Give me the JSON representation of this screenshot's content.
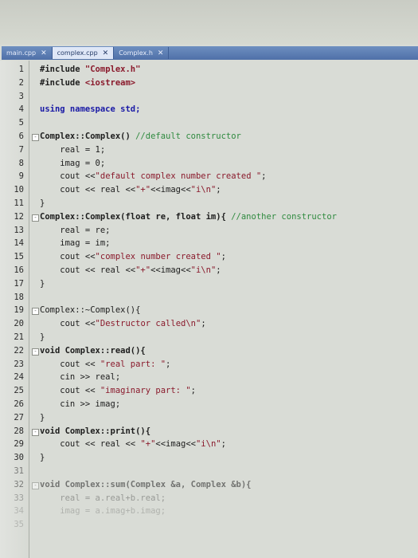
{
  "tabs": [
    {
      "label": "main.cpp",
      "active": false
    },
    {
      "label": "complex.cpp",
      "active": true
    },
    {
      "label": "Complex.h",
      "active": false
    }
  ],
  "lines": [
    {
      "n": "1",
      "parts": [
        {
          "t": "#include ",
          "c": "bold"
        },
        {
          "t": "\"Complex.h\"",
          "c": "str bold"
        }
      ]
    },
    {
      "n": "2",
      "parts": [
        {
          "t": "#include ",
          "c": "bold"
        },
        {
          "t": "<iostream>",
          "c": "str bold"
        }
      ]
    },
    {
      "n": "3",
      "parts": []
    },
    {
      "n": "4",
      "parts": [
        {
          "t": "using namespace std;",
          "c": "kw"
        }
      ]
    },
    {
      "n": "5",
      "parts": []
    },
    {
      "n": "6",
      "parts": [
        {
          "t": "Complex::Complex() ",
          "c": "bold"
        },
        {
          "t": "//default constructor",
          "c": "cm"
        }
      ]
    },
    {
      "n": "7",
      "parts": [
        {
          "t": "    real = 1;",
          "c": ""
        }
      ]
    },
    {
      "n": "8",
      "parts": [
        {
          "t": "    imag = 0;",
          "c": ""
        }
      ]
    },
    {
      "n": "9",
      "parts": [
        {
          "t": "    cout <<",
          "c": ""
        },
        {
          "t": "\"default complex number created \"",
          "c": "str"
        },
        {
          "t": ";",
          "c": ""
        }
      ]
    },
    {
      "n": "10",
      "parts": [
        {
          "t": "    cout << real <<",
          "c": ""
        },
        {
          "t": "\"+\"",
          "c": "str"
        },
        {
          "t": "<<imag<<",
          "c": ""
        },
        {
          "t": "\"i\\n\"",
          "c": "str"
        },
        {
          "t": ";",
          "c": ""
        }
      ]
    },
    {
      "n": "11",
      "parts": [
        {
          "t": "}",
          "c": ""
        }
      ]
    },
    {
      "n": "12",
      "parts": [
        {
          "t": "Complex::Complex(float re, float im){ ",
          "c": "bold"
        },
        {
          "t": "//another constructor",
          "c": "cm"
        }
      ]
    },
    {
      "n": "13",
      "parts": [
        {
          "t": "    real = re;",
          "c": ""
        }
      ]
    },
    {
      "n": "14",
      "parts": [
        {
          "t": "    imag = im;",
          "c": ""
        }
      ]
    },
    {
      "n": "15",
      "parts": [
        {
          "t": "    cout <<",
          "c": ""
        },
        {
          "t": "\"complex number created \"",
          "c": "str"
        },
        {
          "t": ";",
          "c": ""
        }
      ]
    },
    {
      "n": "16",
      "parts": [
        {
          "t": "    cout << real <<",
          "c": ""
        },
        {
          "t": "\"+\"",
          "c": "str"
        },
        {
          "t": "<<imag<<",
          "c": ""
        },
        {
          "t": "\"i\\n\"",
          "c": "str"
        },
        {
          "t": ";",
          "c": ""
        }
      ]
    },
    {
      "n": "17",
      "parts": [
        {
          "t": "}",
          "c": ""
        }
      ]
    },
    {
      "n": "18",
      "parts": []
    },
    {
      "n": "19",
      "parts": [
        {
          "t": "Complex::~Complex(){",
          "c": ""
        }
      ]
    },
    {
      "n": "20",
      "parts": [
        {
          "t": "    cout <<",
          "c": ""
        },
        {
          "t": "\"Destructor called\\n\"",
          "c": "str"
        },
        {
          "t": ";",
          "c": ""
        }
      ]
    },
    {
      "n": "21",
      "parts": [
        {
          "t": "}",
          "c": ""
        }
      ]
    },
    {
      "n": "22",
      "parts": [
        {
          "t": "void Complex::read(){",
          "c": "bold"
        }
      ]
    },
    {
      "n": "23",
      "parts": [
        {
          "t": "    cout << ",
          "c": ""
        },
        {
          "t": "\"real part: \"",
          "c": "str"
        },
        {
          "t": ";",
          "c": ""
        }
      ]
    },
    {
      "n": "24",
      "parts": [
        {
          "t": "    cin >> real;",
          "c": ""
        }
      ]
    },
    {
      "n": "25",
      "parts": [
        {
          "t": "    cout << ",
          "c": ""
        },
        {
          "t": "\"imaginary part: \"",
          "c": "str"
        },
        {
          "t": ";",
          "c": ""
        }
      ]
    },
    {
      "n": "26",
      "parts": [
        {
          "t": "    cin >> imag;",
          "c": ""
        }
      ]
    },
    {
      "n": "27",
      "parts": [
        {
          "t": "}",
          "c": ""
        }
      ]
    },
    {
      "n": "28",
      "parts": [
        {
          "t": "void Complex::print(){",
          "c": "bold"
        }
      ]
    },
    {
      "n": "29",
      "parts": [
        {
          "t": "    cout << real << ",
          "c": ""
        },
        {
          "t": "\"+\"",
          "c": "str"
        },
        {
          "t": "<<imag<<",
          "c": ""
        },
        {
          "t": "\"i\\n\"",
          "c": "str"
        },
        {
          "t": ";",
          "c": ""
        }
      ]
    },
    {
      "n": "30",
      "parts": [
        {
          "t": "}",
          "c": ""
        }
      ]
    },
    {
      "n": "31",
      "parts": []
    },
    {
      "n": "32",
      "parts": [
        {
          "t": "void Complex::sum(Complex &a, Complex &b){",
          "c": "bold"
        }
      ]
    },
    {
      "n": "33",
      "parts": [
        {
          "t": "    real = a.real+b.real;",
          "c": ""
        }
      ]
    },
    {
      "n": "34",
      "parts": [
        {
          "t": "    imag = a.imag+b.imag;",
          "c": ""
        }
      ]
    },
    {
      "n": "35",
      "parts": []
    }
  ]
}
